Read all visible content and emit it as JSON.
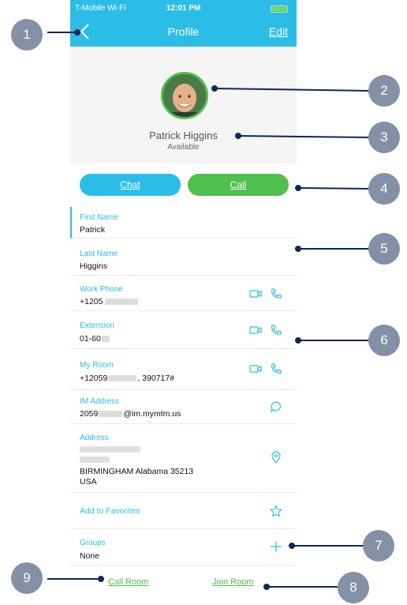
{
  "status_bar": {
    "carrier": "T-Mobile Wi-Fi",
    "time": "12:01 PM"
  },
  "nav": {
    "title": "Profile",
    "edit_label": "Edit",
    "back_icon": "chevron-left-icon"
  },
  "contact": {
    "name": "Patrick Higgins",
    "presence": "Available"
  },
  "actions": {
    "chat_label": "Chat",
    "call_label": "Call"
  },
  "fields": {
    "first_name": {
      "label": "First Name",
      "value": "Patrick"
    },
    "last_name": {
      "label": "Last Name",
      "value": "Higgins"
    },
    "work_phone": {
      "label": "Work Phone",
      "value": "+1205"
    },
    "extension": {
      "label": "Extension",
      "value": "01-60"
    },
    "my_room": {
      "label": "My Room",
      "value_prefix": "+12059",
      "value_suffix": ", 390717#"
    },
    "im_address": {
      "label": "IM Address",
      "value_prefix": "2059",
      "value_suffix": "@im.mymtm.us"
    },
    "address": {
      "label": "Address",
      "line3": "BIRMINGHAM Alabama 35213",
      "line4": "USA"
    },
    "favorites": {
      "label": "Add to Favorites"
    },
    "groups": {
      "label": "Groups",
      "value": "None"
    }
  },
  "footer": {
    "call_room_label": "Call Room",
    "join_room_label": "Join Room"
  },
  "callouts": [
    "1",
    "2",
    "3",
    "4",
    "5",
    "6",
    "7",
    "8",
    "9"
  ],
  "colors": {
    "accent_blue": "#2cbde6",
    "accent_green": "#4fbf4d",
    "callout": "#8391a7"
  }
}
